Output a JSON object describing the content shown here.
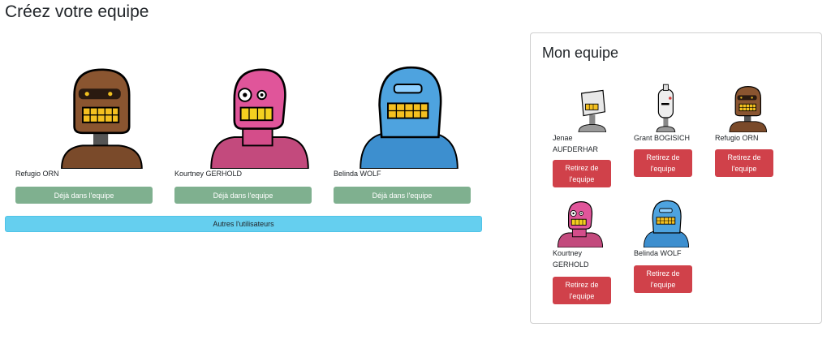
{
  "page_title": "Créez votre equipe",
  "candidates": [
    {
      "name": "Refugio ORN",
      "button": "Déjà dans l'equipe",
      "robot": "brown-robot-icon"
    },
    {
      "name": "Kourtney GERHOLD",
      "button": "Déjà dans l'equipe",
      "robot": "pink-robot-icon"
    },
    {
      "name": "Belinda WOLF",
      "button": "Déjà dans l'equipe",
      "robot": "blue-robot-icon"
    }
  ],
  "others_button": "Autres l'utilisateurs",
  "team": {
    "title": "Mon equipe",
    "members": [
      {
        "name": "Jenae AUFDERHAR",
        "button": "Retirez de l'equipe",
        "robot": "white-robot-icon"
      },
      {
        "name": "Grant BOGISICH",
        "button": "Retirez de l'equipe",
        "robot": "white-tall-robot-icon"
      },
      {
        "name": "Refugio ORN",
        "button": "Retirez de l'equipe",
        "robot": "brown-robot-icon"
      },
      {
        "name": "Kourtney GERHOLD",
        "button": "Retirez de l'equipe",
        "robot": "pink-robot-icon"
      },
      {
        "name": "Belinda WOLF",
        "button": "Retirez de l'equipe",
        "robot": "blue-robot-icon"
      }
    ]
  },
  "colors": {
    "in_team_button": "#7fb08f",
    "others_button": "#65cfef",
    "remove_button": "#d0414a"
  }
}
